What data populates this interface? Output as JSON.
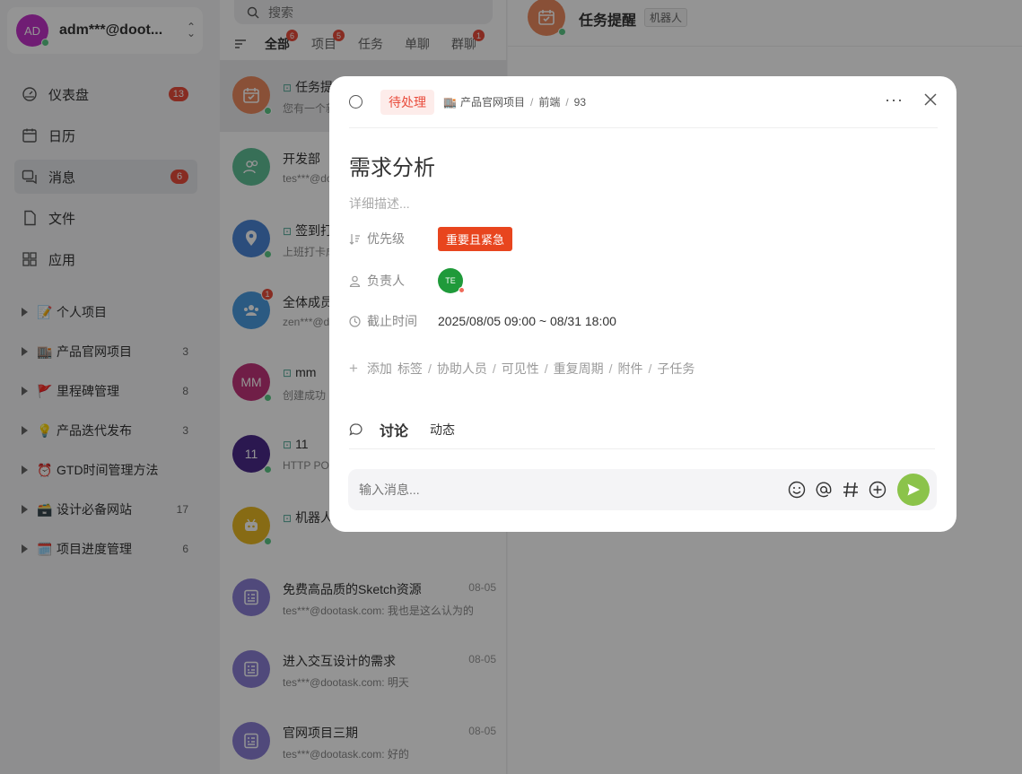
{
  "user": {
    "initials": "AD",
    "name": "adm***@doot..."
  },
  "nav": [
    {
      "label": "仪表盘",
      "badge": "13",
      "icon": "dashboard-icon"
    },
    {
      "label": "日历",
      "badge": "",
      "icon": "calendar-icon"
    },
    {
      "label": "消息",
      "badge": "6",
      "icon": "message-icon"
    },
    {
      "label": "文件",
      "badge": "",
      "icon": "file-icon"
    },
    {
      "label": "应用",
      "badge": "",
      "icon": "apps-icon"
    }
  ],
  "projects": [
    {
      "emoji": "📝",
      "label": "个人项目",
      "count": ""
    },
    {
      "emoji": "🏬",
      "label": "产品官网项目",
      "count": "3"
    },
    {
      "emoji": "🚩",
      "label": "里程碑管理",
      "count": "8"
    },
    {
      "emoji": "💡",
      "label": "产品迭代发布",
      "count": "3"
    },
    {
      "emoji": "⏰",
      "label": "GTD时间管理方法",
      "count": ""
    },
    {
      "emoji": "🗃️",
      "label": "设计必备网站",
      "count": "17"
    },
    {
      "emoji": "🗓️",
      "label": "项目进度管理",
      "count": "6"
    }
  ],
  "search": {
    "placeholder": "搜索"
  },
  "tabs": [
    {
      "label": "全部",
      "badge": "6"
    },
    {
      "label": "项目",
      "badge": "5"
    },
    {
      "label": "任务",
      "badge": ""
    },
    {
      "label": "单聊",
      "badge": ""
    },
    {
      "label": "群聊",
      "badge": "1"
    }
  ],
  "messages": [
    {
      "title": "任务提醒",
      "sub": "您有一个新",
      "date": "",
      "avatar": "",
      "color": "#ed8a5f"
    },
    {
      "title": "开发部",
      "sub": "tes***@dootask.com",
      "date": "",
      "avatar": "",
      "color": "#5fbf96"
    },
    {
      "title": "签到打卡",
      "sub": "上班打卡成功",
      "date": "",
      "avatar": "",
      "color": "#4a86d6"
    },
    {
      "title": "全体成员",
      "sub": "zen***@dootask.com",
      "date": "",
      "avatar": "",
      "color": "#4a9be0",
      "badge": "1"
    },
    {
      "title": "mm",
      "sub": "创建成功",
      "date": "",
      "avatar": "MM",
      "color": "#c2357a"
    },
    {
      "title": "11",
      "sub": "HTTP POST",
      "date": "",
      "avatar": "11",
      "color": "#4a2a8a"
    },
    {
      "title": "机器人",
      "sub": "",
      "date": "",
      "avatar": "",
      "color": "#e8b923"
    },
    {
      "title": "免费高品质的Sketch资源",
      "sub": "tes***@dootask.com: 我也是这么认为的",
      "date": "08-05",
      "avatar": "",
      "color": "#8a7fd4"
    },
    {
      "title": "进入交互设计的需求",
      "sub": "tes***@dootask.com: 明天",
      "date": "08-05",
      "avatar": "",
      "color": "#8a7fd4"
    },
    {
      "title": "官网项目三期",
      "sub": "tes***@dootask.com: 好的",
      "date": "08-05",
      "avatar": "",
      "color": "#8a7fd4"
    }
  ],
  "chat": {
    "title": "任务提醒",
    "tag": "机器人"
  },
  "task": {
    "status": "待处理",
    "crumb_project": "产品官网项目",
    "crumb_column": "前端",
    "crumb_id": "93",
    "title": "需求分析",
    "desc_placeholder": "详细描述...",
    "priority_label": "优先级",
    "priority_value": "重要且紧急",
    "owner_label": "负责人",
    "owner_initials": "TE",
    "deadline_label": "截止时间",
    "deadline_value": "2025/08/05 09:00 ~ 08/31 18:00",
    "add_label": "添加",
    "add_items": [
      "标签",
      "协助人员",
      "可见性",
      "重复周期",
      "附件",
      "子任务"
    ],
    "tab_discuss": "讨论",
    "tab_activity": "动态",
    "input_placeholder": "输入消息..."
  }
}
